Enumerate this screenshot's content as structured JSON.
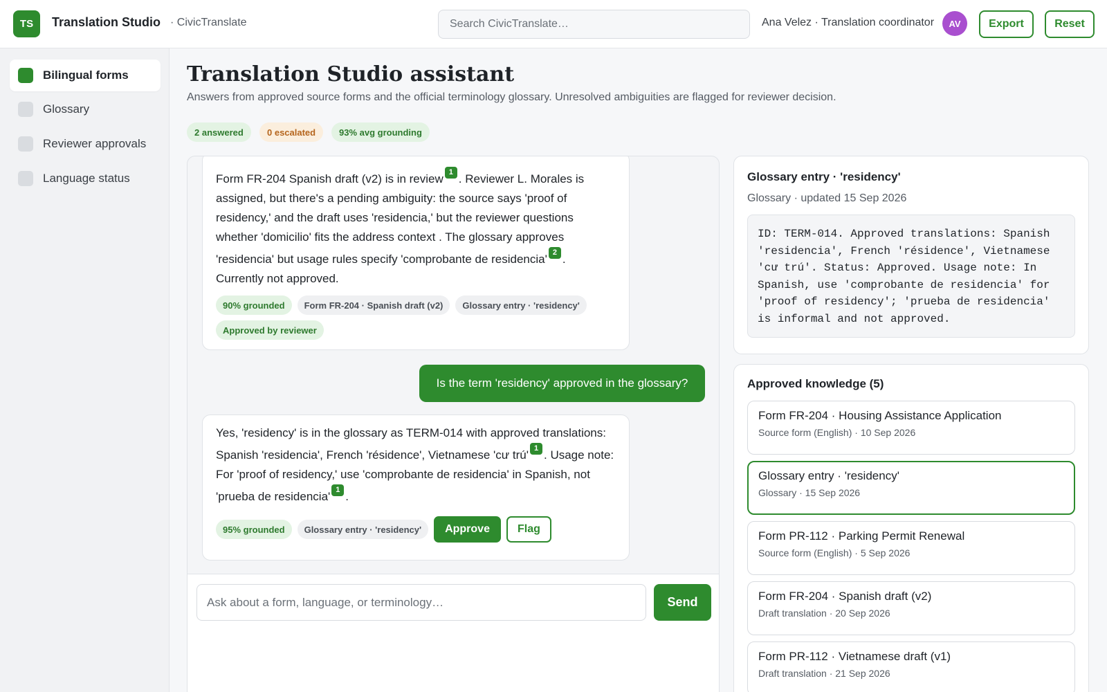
{
  "header": {
    "logo": "TS",
    "app_name": "Translation Studio",
    "org": "· CivicTranslate",
    "search_placeholder": "Search CivicTranslate…",
    "user": "Ana Velez · Translation coordinator",
    "avatar": "AV",
    "export_label": "Export",
    "reset_label": "Reset"
  },
  "sidebar": {
    "items": [
      {
        "label": "Bilingual forms",
        "active": true
      },
      {
        "label": "Glossary",
        "active": false
      },
      {
        "label": "Reviewer approvals",
        "active": false
      },
      {
        "label": "Language status",
        "active": false
      }
    ]
  },
  "main": {
    "title": "Translation Studio assistant",
    "subtitle": "Answers from approved source forms and the official terminology glossary. Unresolved ambiguities are flagged for reviewer decision.",
    "stats": [
      "2 answered",
      "0 escalated",
      "93% avg grounding"
    ]
  },
  "chat": {
    "msg1": {
      "seg1": "Form FR-204 Spanish draft (v2) is in review",
      "cite1": "1",
      "seg2": ". Reviewer L. Morales is assigned, but there's a pending ambiguity: the source says 'proof of residency,' and the draft uses 'residencia,' but the reviewer questions whether 'domicilio' fits the address context . The glossary approves 'residencia' but usage rules specify 'comprobante de residencia'",
      "cite2": "2",
      "seg3": ". Currently not approved.",
      "chips": [
        "90% grounded",
        "Form FR-204 · Spanish draft (v2)",
        "Glossary entry · 'residency'",
        "Approved by reviewer"
      ]
    },
    "user_msg": "Is the term 'residency' approved in the glossary?",
    "msg3": {
      "seg1": "Yes, 'residency' is in the glossary as TERM-014 with approved translations: Spanish 'residencia', French 'résidence', Vietnamese 'cư trú'",
      "cite1": "1",
      "seg2": ". Usage note: For 'proof of residency,' use 'comprobante de residencia' in Spanish, not 'prueba de residencia'",
      "cite2": "1",
      "seg3": ".",
      "chips": [
        "95% grounded",
        "Glossary entry · 'residency'"
      ],
      "approve_label": "Approve",
      "flag_label": "Flag"
    },
    "composer_placeholder": "Ask about a form, language, or terminology…",
    "send_label": "Send"
  },
  "glossary_card": {
    "title": "Glossary entry · 'residency'",
    "meta": "Glossary · updated 15 Sep 2026",
    "body": "ID: TERM-014. Approved translations: Spanish 'residencia', French 'résidence', Vietnamese 'cư trú'. Status: Approved. Usage note: In Spanish, use 'comprobante de residencia' for 'proof of residency'; 'prueba de residencia' is informal and not approved."
  },
  "knowledge": {
    "title": "Approved knowledge (5)",
    "items": [
      {
        "title": "Form FR-204 · Housing Assistance Application",
        "meta": "Source form (English) · 10 Sep 2026"
      },
      {
        "title": "Glossary entry · 'residency'",
        "meta": "Glossary · 15 Sep 2026"
      },
      {
        "title": "Form PR-112 · Parking Permit Renewal",
        "meta": "Source form (English) · 5 Sep 2026"
      },
      {
        "title": "Form FR-204 · Spanish draft (v2)",
        "meta": "Draft translation · 20 Sep 2026"
      },
      {
        "title": "Form PR-112 · Vietnamese draft (v1)",
        "meta": "Draft translation · 21 Sep 2026"
      }
    ]
  },
  "colors": {
    "accent": "#2e8b2e",
    "avatar": "#a94fcf",
    "escalated": "#b5651d"
  }
}
